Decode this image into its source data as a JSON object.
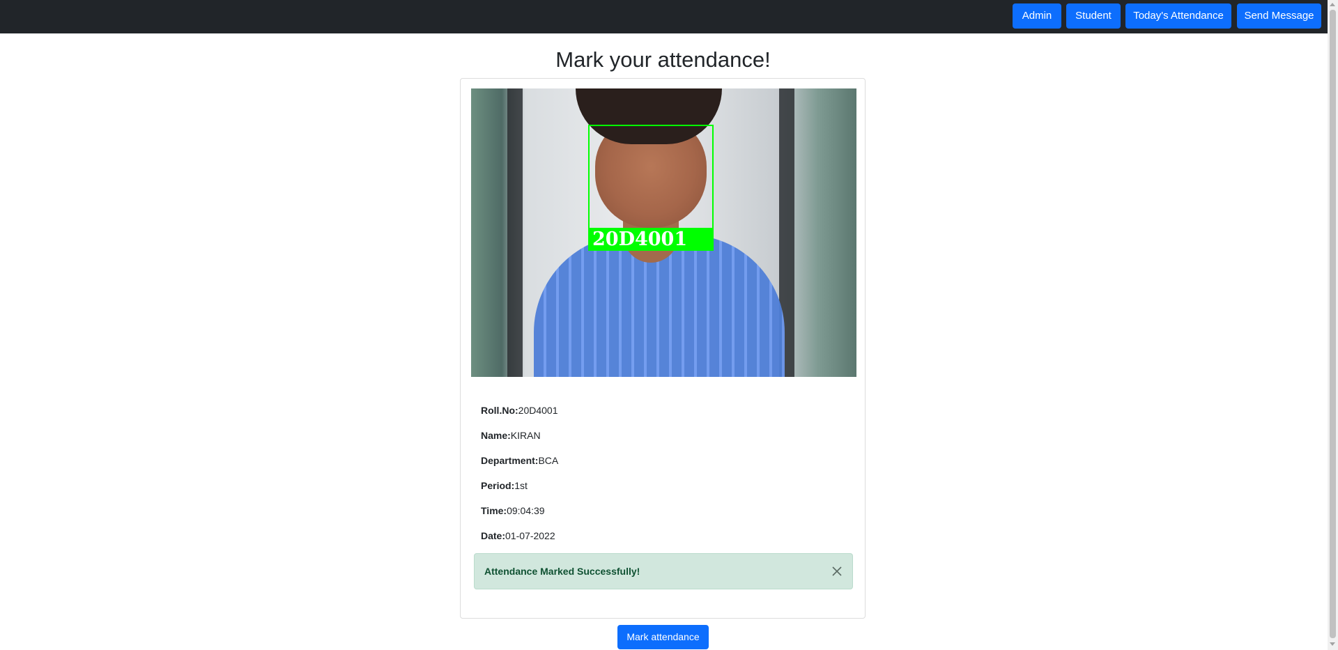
{
  "nav": {
    "admin": "Admin",
    "student": "Student",
    "todays_attendance": "Today's Attendance",
    "send_message": "Send Message"
  },
  "page_title": "Mark your attendance!",
  "camera": {
    "face_label": "20D4001",
    "box_color": "#00ff00"
  },
  "details": [
    {
      "label": "Roll.No:",
      "value": "20D4001"
    },
    {
      "label": "Name:",
      "value": "KIRAN"
    },
    {
      "label": "Department:",
      "value": "BCA"
    },
    {
      "label": "Period:",
      "value": "1st"
    },
    {
      "label": "Time:",
      "value": "09:04:39"
    },
    {
      "label": "Date:",
      "value": "01-07-2022"
    }
  ],
  "alert": {
    "message": "Attendance Marked Successfully!",
    "close_icon": "close-icon"
  },
  "mark_button": "Mark attendance",
  "colors": {
    "navbar": "#212529",
    "primary": "#0d6efd",
    "success_bg": "#d1e7dd",
    "success_text": "#0f5132"
  }
}
